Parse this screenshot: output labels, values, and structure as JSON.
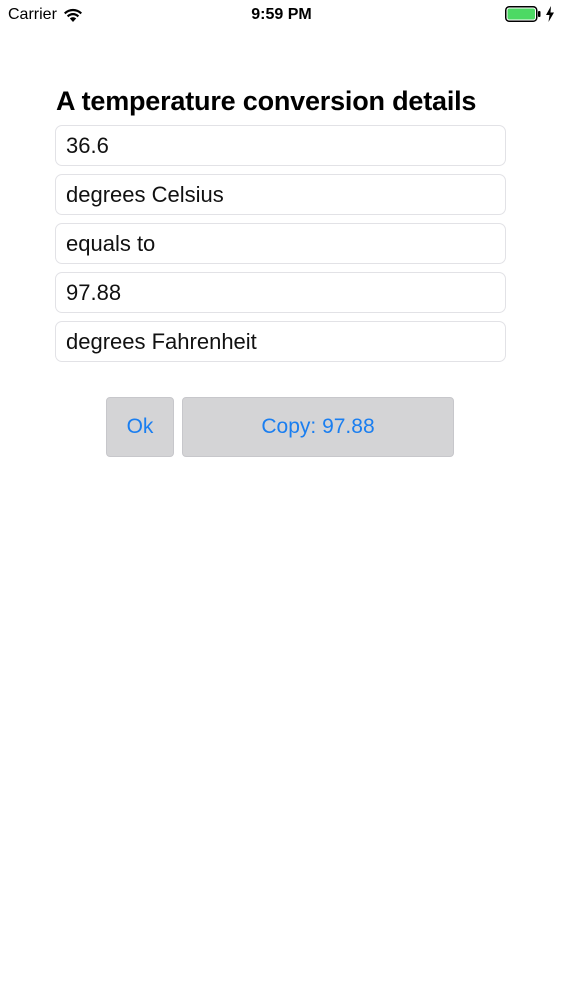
{
  "status_bar": {
    "carrier": "Carrier",
    "time": "9:59 PM",
    "icons": [
      "wifi-icon",
      "battery-icon",
      "charging-bolt-icon"
    ],
    "battery_color": "#4cd964"
  },
  "main": {
    "title": "A temperature conversion details",
    "fields": [
      {
        "name": "input-value-field",
        "value": "36.6"
      },
      {
        "name": "input-unit-field",
        "value": "degrees Celsius"
      },
      {
        "name": "relation-field",
        "value": "equals to"
      },
      {
        "name": "result-value-field",
        "value": "97.88"
      },
      {
        "name": "result-unit-field",
        "value": "degrees Fahrenheit"
      }
    ],
    "buttons": {
      "ok_label": "Ok",
      "copy_label": "Copy: 97.88"
    }
  },
  "colors": {
    "button_text": "#1a7ef0",
    "button_background": "#d4d4d6",
    "field_border": "#e2e2e6"
  }
}
